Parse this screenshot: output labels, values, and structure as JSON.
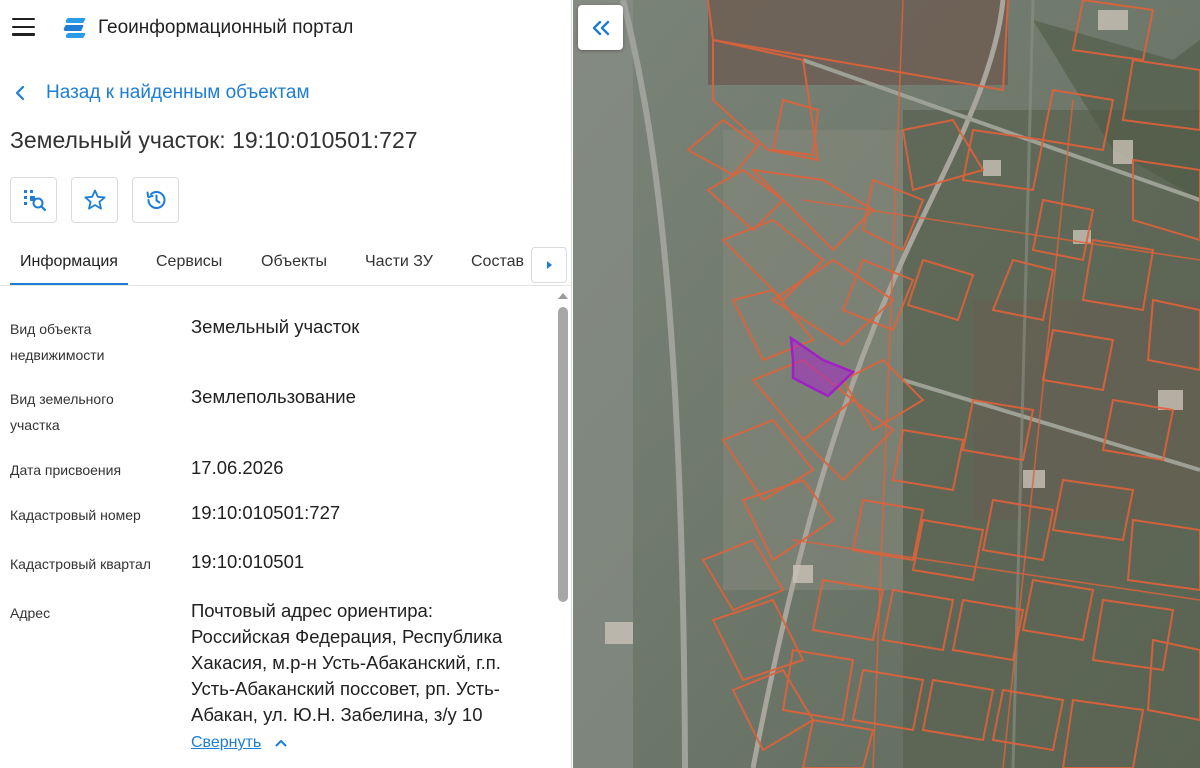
{
  "header": {
    "title": "Геоинформационный портал"
  },
  "nav": {
    "back_label": "Назад к найденным объектам"
  },
  "object": {
    "title": "Земельный участок: 19:10:010501:727"
  },
  "toolbar": {
    "buttons": [
      {
        "icon": "locate-on-map-icon"
      },
      {
        "icon": "favorite-star-icon"
      },
      {
        "icon": "history-icon"
      }
    ]
  },
  "tabs": {
    "items": [
      {
        "label": "Информация",
        "active": true
      },
      {
        "label": "Сервисы",
        "active": false
      },
      {
        "label": "Объекты",
        "active": false
      },
      {
        "label": "Части ЗУ",
        "active": false
      },
      {
        "label": "Состав",
        "active": false
      }
    ],
    "more_icon": "caret-right-icon"
  },
  "info": {
    "rows": [
      {
        "label": "Вид объекта недвижимости",
        "value": "Земельный участок"
      },
      {
        "label": "Вид земельного участка",
        "value": "Землепользование"
      },
      {
        "label": "Дата присвоения",
        "value": "17.06.2026"
      },
      {
        "label": "Кадастровый номер",
        "value": "19:10:010501:727"
      },
      {
        "label": "Кадастровый квартал",
        "value": "19:10:010501"
      },
      {
        "label": "Адрес",
        "value": "Почтовый адрес ориентира: Российская Федерация, Республика Хакасия, м.р-н Усть-Абаканский, г.п. Усть-Абаканский поссовет, рп. Усть-Абакан, ул. Ю.Н. Забелина, з/у 10"
      }
    ],
    "collapse_label": "Свернуть"
  },
  "map": {
    "collapse_icon": "double-chevron-left-icon",
    "parcel_color": "#e0623a",
    "selected_parcel_color": "#a020c8"
  },
  "colors": {
    "accent": "#1e7ed6",
    "text": "#212121"
  }
}
